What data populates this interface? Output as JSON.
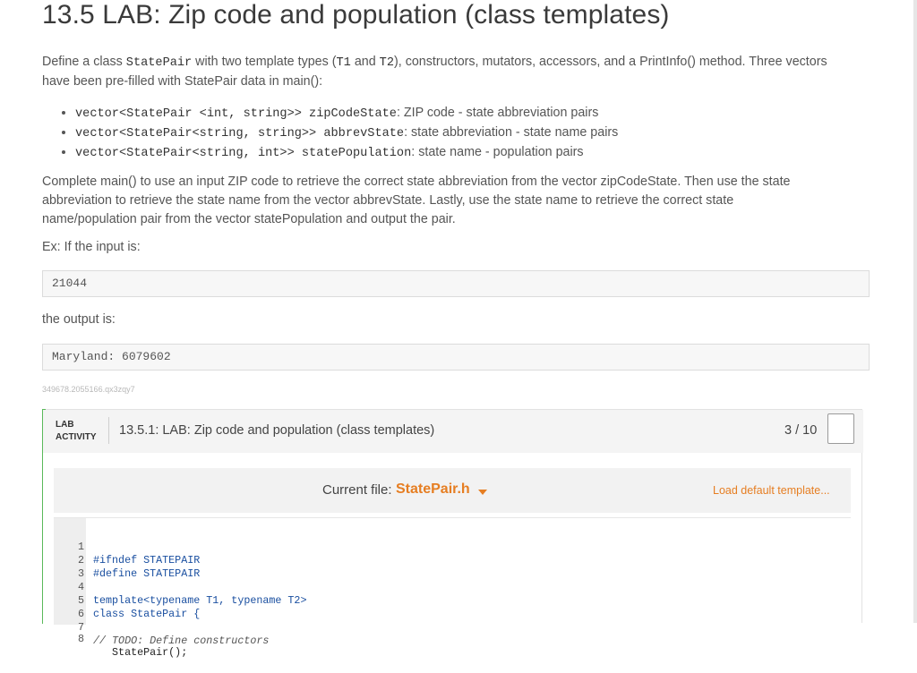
{
  "page": {
    "title": "13.5 LAB: Zip code and population (class templates)",
    "intro": {
      "p1": "Define a class ",
      "class_name": "StatePair",
      "p2": " with two template types (",
      "t1": "T1",
      "p3": " and ",
      "t2": "T2",
      "p4": "), constructors, mutators, accessors, and a PrintInfo() method. Three vectors",
      "line2": "have been pre-filled with StatePair data in main():"
    },
    "vectors": [
      {
        "code": "vector<StatePair <int, string>> zipCodeState",
        "desc": ": ZIP code - state abbreviation pairs"
      },
      {
        "code": "vector<StatePair<string, string>> abbrevState",
        "desc": ": state abbreviation - state name pairs"
      },
      {
        "code": "vector<StatePair<string, int>> statePopulation",
        "desc": ": state name - population pairs"
      }
    ],
    "instructions": [
      "Complete main() to use an input ZIP code to retrieve the correct state abbreviation from the vector zipCodeState. Then use the state",
      "abbreviation to retrieve the state name from the vector abbrevState. Lastly, use the state name to retrieve the correct state",
      "name/population pair from the vector statePopulation and output the pair."
    ],
    "example_label": "Ex: If the input is:",
    "example_input": "21044",
    "output_label": "the output is:",
    "example_output": "Maryland: 6079602",
    "activity_id": "349678.2055166.qx3zqy7"
  },
  "lab": {
    "tag_line1": "LAB",
    "tag_line2": "ACTIVITY",
    "title": "13.5.1: LAB: Zip code and population (class templates)",
    "score": "3 / 10",
    "current_file_label": "Current file:",
    "current_file": "StatePair.h",
    "load_default": "Load default template...",
    "code_lines": [
      {
        "n": "1",
        "text": "#ifndef STATEPAIR"
      },
      {
        "n": "2",
        "text": "#define STATEPAIR"
      },
      {
        "n": "3",
        "text": ""
      },
      {
        "n": "4",
        "text": "template<typename T1, typename T2>"
      },
      {
        "n": "5",
        "text": "class StatePair {"
      },
      {
        "n": "6",
        "text": ""
      },
      {
        "n": "7",
        "text": "// TODO: Define constructors"
      },
      {
        "n": "8",
        "text": "   StatePair();"
      }
    ]
  },
  "colors": {
    "accent": "#e67e22",
    "lab_stripe": "#5ab95a"
  }
}
